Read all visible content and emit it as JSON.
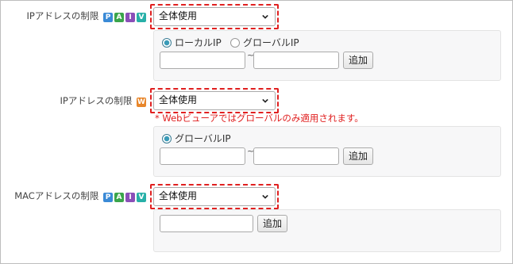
{
  "ip_restriction": {
    "label": "IPアドレスの制限",
    "badges": [
      {
        "text": "P",
        "color": "#3a8ad6"
      },
      {
        "text": "A",
        "color": "#3aa54a"
      },
      {
        "text": "I",
        "color": "#8a4fb8"
      },
      {
        "text": "V",
        "color": "#27b0a8"
      }
    ],
    "select_value": "全体使用",
    "radio_local": "ローカルIP",
    "radio_global": "グローバルIP",
    "radio_selected": "local",
    "range_from": "",
    "range_to": "",
    "tilde": "~",
    "add_label": "追加"
  },
  "ip_restriction_web": {
    "label": "IPアドレスの制限",
    "badge": {
      "text": "W",
      "color": "#e8862a"
    },
    "select_value": "全体使用",
    "note": "* Webビューアではグローバルのみ適用されます。",
    "radio_global": "グローバルIP",
    "range_from": "",
    "range_to": "",
    "tilde": "~",
    "add_label": "追加"
  },
  "mac_restriction": {
    "label": "MACアドレスの制限",
    "badges": [
      {
        "text": "P",
        "color": "#3a8ad6"
      },
      {
        "text": "A",
        "color": "#3aa54a"
      },
      {
        "text": "I",
        "color": "#8a4fb8"
      },
      {
        "text": "V",
        "color": "#27b0a8"
      }
    ],
    "select_value": "全体使用",
    "mac_value": "",
    "add_label": "追加"
  }
}
